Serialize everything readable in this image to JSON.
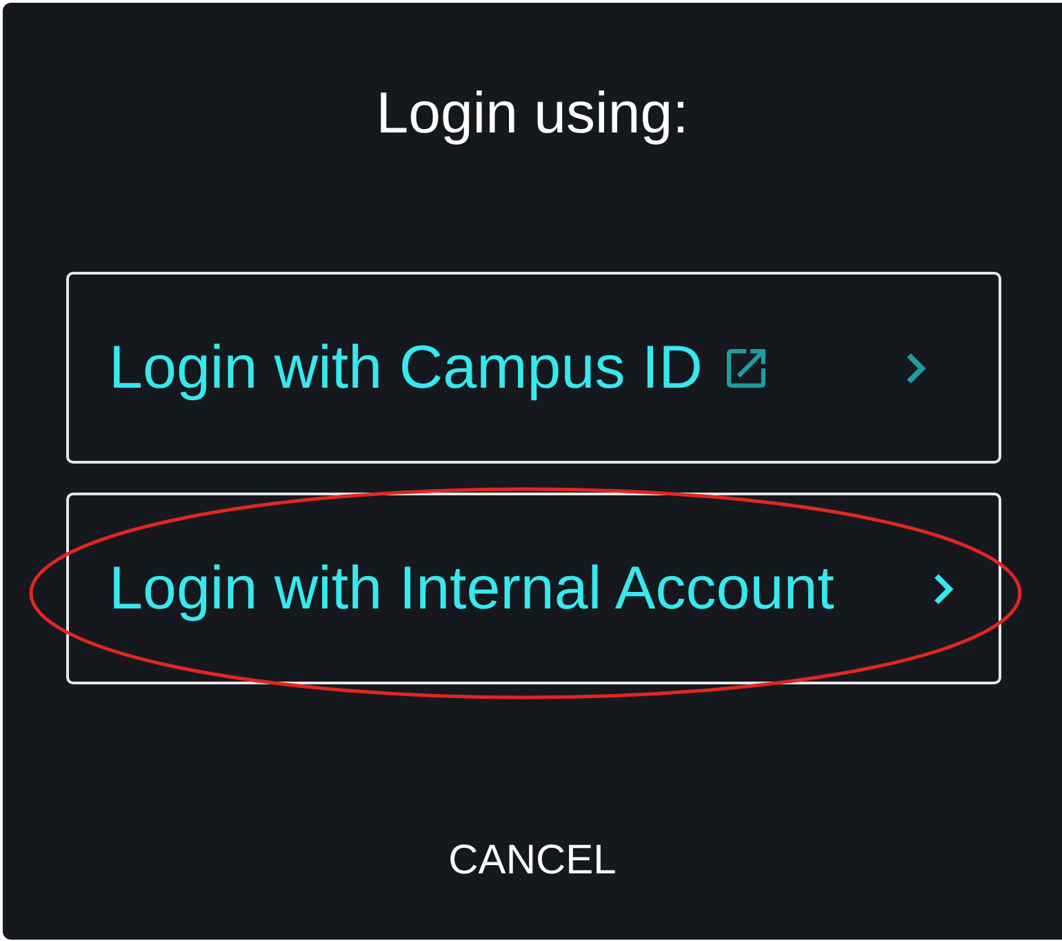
{
  "dialog": {
    "title": "Login using:",
    "options": [
      {
        "label": "Login with Campus ID",
        "external": true,
        "hovered": false,
        "circled": false
      },
      {
        "label": "Login with Internal Account",
        "external": false,
        "hovered": true,
        "circled": true
      }
    ],
    "cancel_button": "CANCEL"
  }
}
